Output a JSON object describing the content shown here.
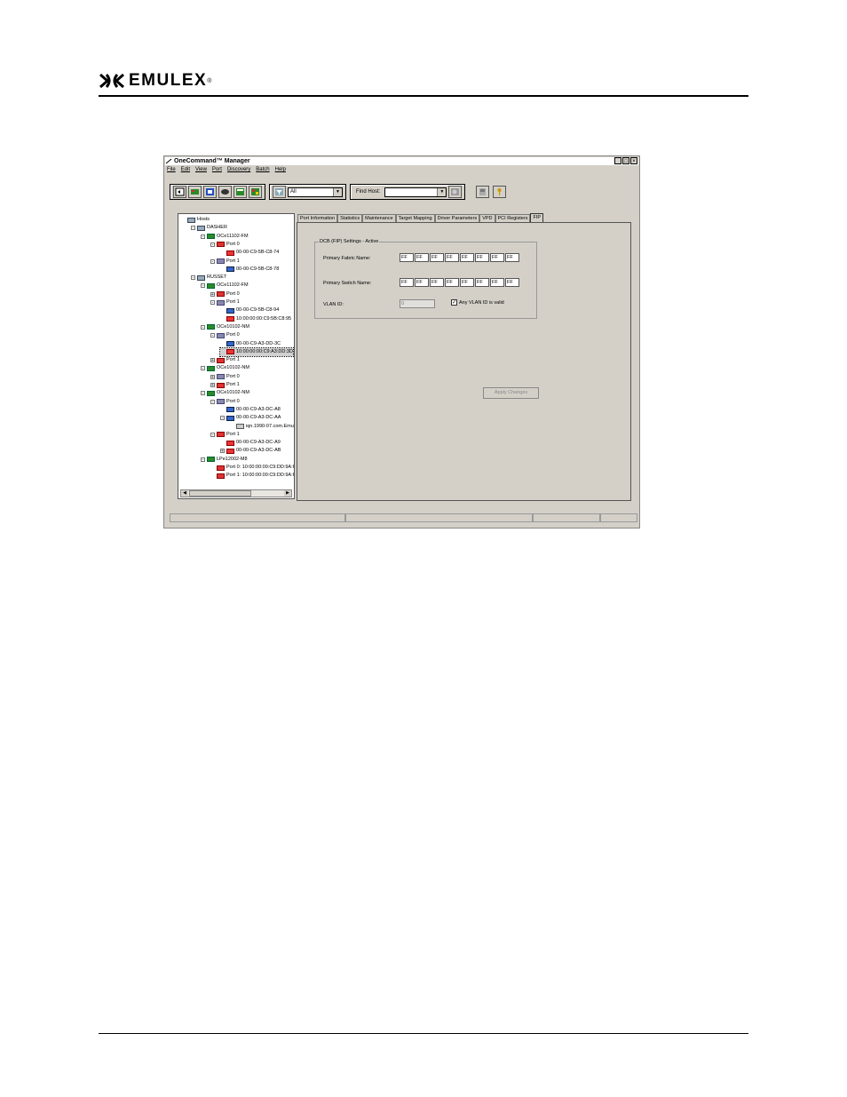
{
  "doc": {
    "logo_text": "EMULEX",
    "logo_tm": "®"
  },
  "window": {
    "title": "OneCommand™ Manager",
    "menu": [
      "File",
      "Edit",
      "View",
      "Port",
      "Discovery",
      "Batch",
      "Help"
    ],
    "toolbar": {
      "filter_value": "All",
      "find_host_label": "Find Host:",
      "find_host_value": ""
    },
    "tree": [
      {
        "label": "Hosts",
        "level": 0,
        "icon": "hosts-icon",
        "exp": ""
      },
      {
        "label": "DASHER",
        "level": 1,
        "icon": "host-icon",
        "exp": "-"
      },
      {
        "label": "OCe11102-FM",
        "level": 2,
        "icon": "adapter-icon",
        "exp": "-"
      },
      {
        "label": "Port 0",
        "level": 3,
        "icon": "port-down-icon",
        "exp": "-"
      },
      {
        "label": "00-00-C9-5B-C8-74",
        "level": 4,
        "icon": "link-down-icon",
        "exp": ""
      },
      {
        "label": "Port 1",
        "level": 3,
        "icon": "port-icon",
        "exp": "-"
      },
      {
        "label": "00-00-C9-5B-C8-78",
        "level": 4,
        "icon": "link-icon",
        "exp": ""
      },
      {
        "label": "RUSSET",
        "level": 1,
        "icon": "host-icon",
        "exp": "-"
      },
      {
        "label": "OCe11102-FM",
        "level": 2,
        "icon": "adapter-icon",
        "exp": "-"
      },
      {
        "label": "Port 0",
        "level": 3,
        "icon": "port-down-icon",
        "exp": "+"
      },
      {
        "label": "Port 1",
        "level": 3,
        "icon": "port-icon",
        "exp": "-"
      },
      {
        "label": "00-00-C9-5B-C8-94",
        "level": 4,
        "icon": "link-icon",
        "exp": ""
      },
      {
        "label": "10:00:00:00:C9:5B:C8:95",
        "level": 4,
        "icon": "fc-down-icon",
        "exp": ""
      },
      {
        "label": "OCe10102-NM",
        "level": 2,
        "icon": "adapter-icon",
        "exp": "-"
      },
      {
        "label": "Port 0",
        "level": 3,
        "icon": "port-icon",
        "exp": "-"
      },
      {
        "label": "00-00-C9-A3-DD-3C",
        "level": 4,
        "icon": "link-icon",
        "exp": ""
      },
      {
        "label": "10:00:00:00:C9:A3:DD:3D",
        "level": 4,
        "icon": "fc-down-icon",
        "exp": "",
        "selected": true
      },
      {
        "label": "Port 1",
        "level": 3,
        "icon": "port-down-icon",
        "exp": "+"
      },
      {
        "label": "OCe10102-NM",
        "level": 2,
        "icon": "adapter-icon",
        "exp": "-"
      },
      {
        "label": "Port 0",
        "level": 3,
        "icon": "port-icon",
        "exp": "+"
      },
      {
        "label": "Port 1",
        "level": 3,
        "icon": "port-down-icon",
        "exp": "+"
      },
      {
        "label": "OCe10102-NM",
        "level": 2,
        "icon": "adapter-icon",
        "exp": "-"
      },
      {
        "label": "Port 0",
        "level": 3,
        "icon": "port-icon",
        "exp": "-"
      },
      {
        "label": "00-00-C9-A3-DC-A8",
        "level": 4,
        "icon": "link-icon",
        "exp": ""
      },
      {
        "label": "00-00-C9-A3-DC-AA",
        "level": 4,
        "icon": "link-icon",
        "exp": "-"
      },
      {
        "label": "iqn.1990-07.com.Emulex",
        "level": 5,
        "icon": "disk-icon",
        "exp": ""
      },
      {
        "label": "Port 1",
        "level": 3,
        "icon": "port-down-icon",
        "exp": "-"
      },
      {
        "label": "00-00-C9-A3-DC-A9",
        "level": 4,
        "icon": "link-down-icon",
        "exp": ""
      },
      {
        "label": "00-00-C9-A3-DC-AB",
        "level": 4,
        "icon": "link-down-icon",
        "exp": "+"
      },
      {
        "label": "LPe12002-M8",
        "level": 2,
        "icon": "adapter-icon",
        "exp": "-"
      },
      {
        "label": "Port 0: 10:00:00:00:C9:DD:9A:6C",
        "level": 3,
        "icon": "port-down-icon",
        "exp": ""
      },
      {
        "label": "Port 1: 10:00:00:00:C9:DD:9A:6D",
        "level": 3,
        "icon": "port-down-icon",
        "exp": ""
      }
    ],
    "tabs": [
      "Port Information",
      "Statistics",
      "Maintenance",
      "Target Mapping",
      "Driver Parameters",
      "VPD",
      "PCI Registers",
      "FIP"
    ],
    "active_tab": "FIP",
    "fip": {
      "group_title": "DCB (FIP) Settings - Active",
      "fabric_label": "Primary Fabric Name:",
      "fabric_octets": [
        "FF",
        "FF",
        "FF",
        "FF",
        "FF",
        "FF",
        "FF",
        "FF"
      ],
      "switch_label": "Primary Switch Name:",
      "switch_octets": [
        "FF",
        "FF",
        "FF",
        "FF",
        "FF",
        "FF",
        "FF",
        "FF"
      ],
      "vlan_label": "VLAN ID:",
      "vlan_value": "0",
      "any_vlan_label": "Any VLAN ID is valid",
      "any_vlan_checked": true,
      "apply_label": "Apply Changes"
    }
  }
}
